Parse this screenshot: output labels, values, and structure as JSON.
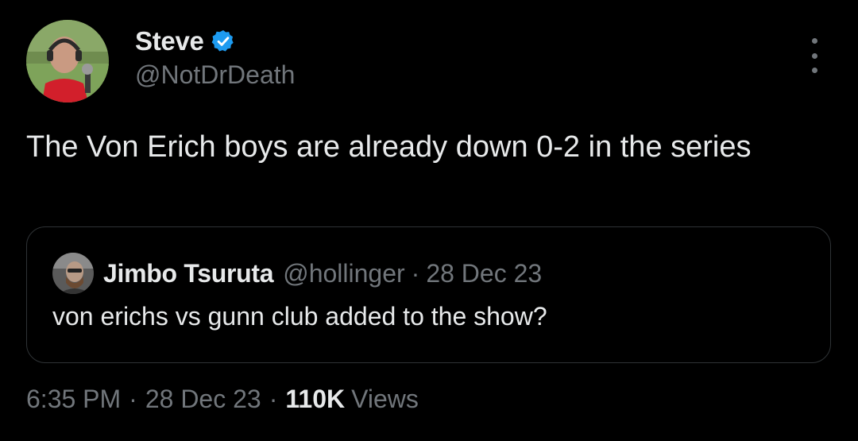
{
  "author": {
    "display_name": "Steve",
    "handle": "@NotDrDeath",
    "verified": true
  },
  "tweet": {
    "text": "The Von Erich boys are already down 0-2 in the series"
  },
  "quoted_tweet": {
    "display_name": "Jimbo Tsuruta",
    "handle": "@hollinger",
    "separator": "·",
    "date": "28 Dec 23",
    "text": "von erichs vs gunn club added to the show?"
  },
  "meta": {
    "time": "6:35 PM",
    "separator": "·",
    "date": "28 Dec 23",
    "views_count": "110K",
    "views_label": "Views"
  },
  "colors": {
    "background": "#000000",
    "primary_text": "#e7e9ea",
    "secondary_text": "#71767b",
    "border": "#2f3336",
    "verified_badge": "#1d9bf0"
  },
  "icons": {
    "verified": "verified-badge-icon",
    "more": "more-options-icon"
  }
}
